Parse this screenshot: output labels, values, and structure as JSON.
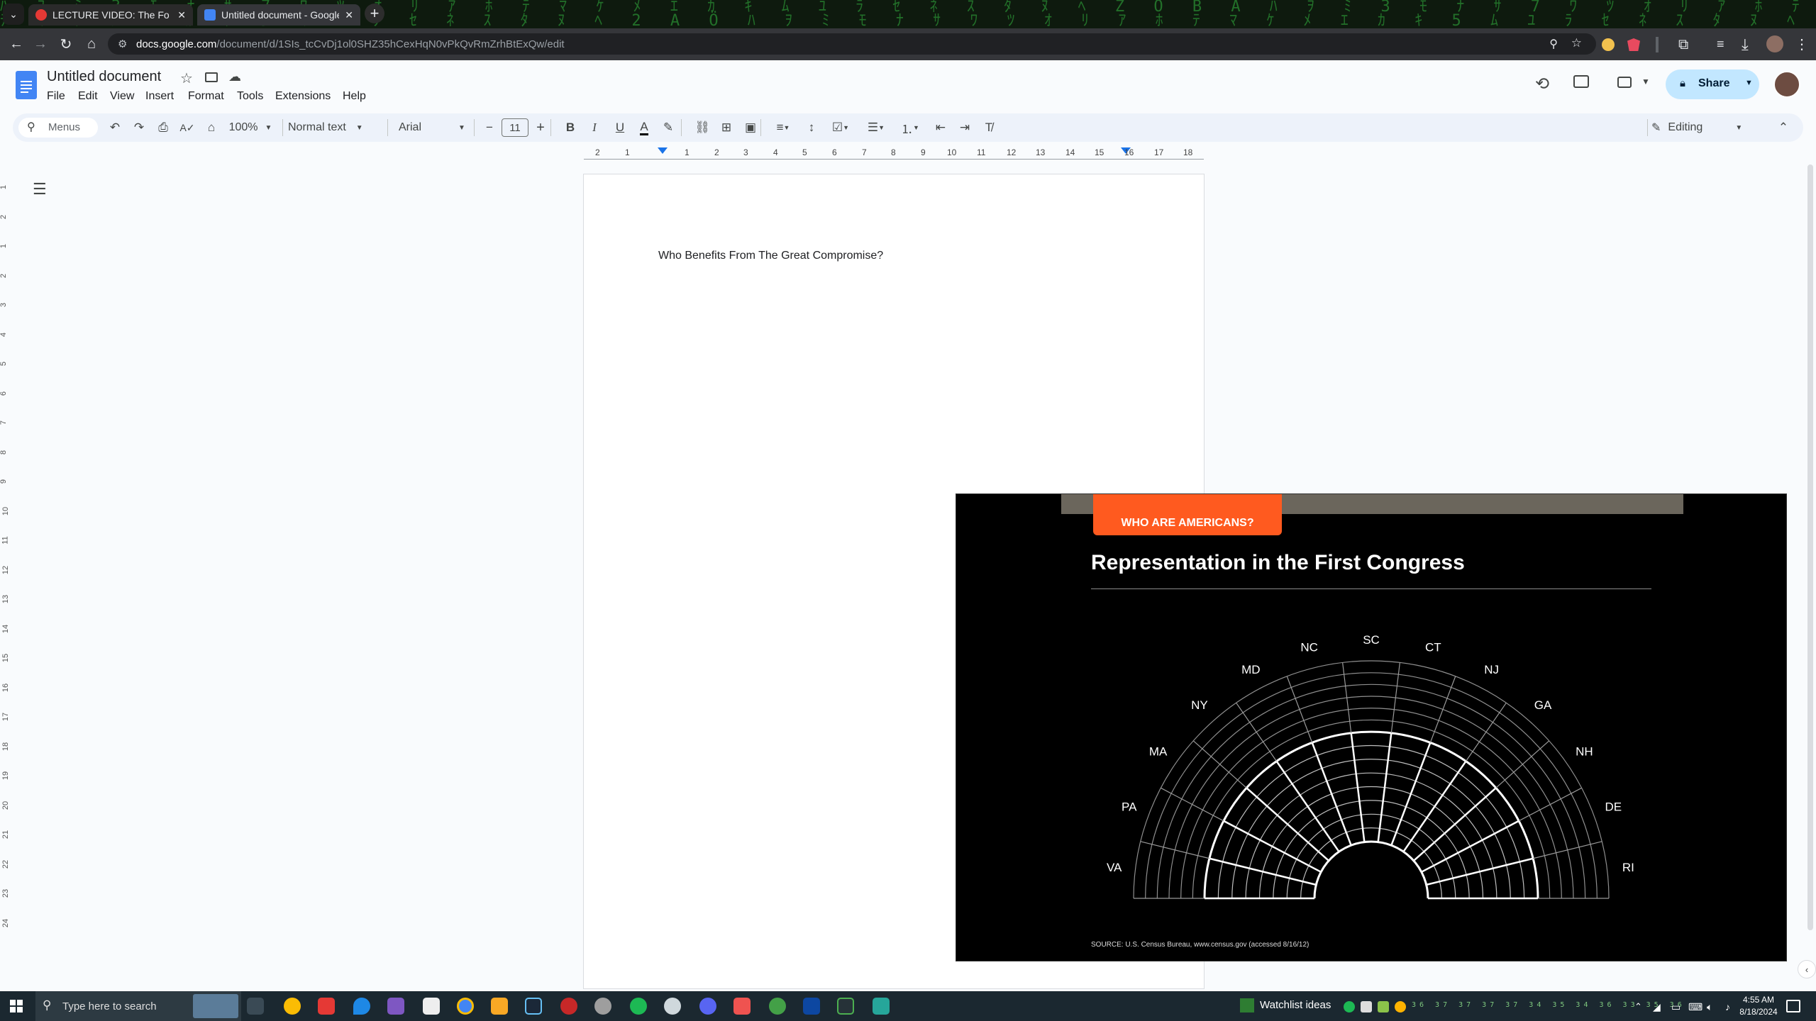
{
  "browser": {
    "tabs": [
      {
        "label": "LECTURE VIDEO: The Fo",
        "active": false
      },
      {
        "label": "Untitled document - Google Do",
        "active": true
      }
    ],
    "url_host": "docs.google.com",
    "url_path": "/document/d/1SIs_tcCvDj1ol0SHZ35hCexHqN0vPkQvRmZrhBtExQw/edit"
  },
  "docs": {
    "title": "Untitled document",
    "menu": [
      "File",
      "Edit",
      "View",
      "Insert",
      "Format",
      "Tools",
      "Extensions",
      "Help"
    ],
    "share_label": "Share",
    "toolbar": {
      "menus_label": "Menus",
      "zoom": "100%",
      "style": "Normal text",
      "font": "Arial",
      "font_size": "11",
      "mode": "Editing"
    },
    "ruler_labels": [
      "2",
      "1",
      "1",
      "2",
      "3",
      "4",
      "5",
      "6",
      "7",
      "8",
      "9",
      "10",
      "11",
      "12",
      "13",
      "14",
      "15",
      "16",
      "17",
      "18"
    ],
    "vruler_labels": [
      "1",
      "2",
      "1",
      "2",
      "3",
      "4",
      "5",
      "6",
      "7",
      "8",
      "9",
      "10",
      "11",
      "12",
      "13",
      "14",
      "15",
      "16",
      "17",
      "18",
      "19",
      "20",
      "21",
      "22",
      "23",
      "24"
    ],
    "body_text": "Who Benefits From The Great Compromise?"
  },
  "video": {
    "tag": "WHO ARE AMERICANS?",
    "title": "Representation in the First Congress",
    "states": [
      "VA",
      "PA",
      "MA",
      "NY",
      "MD",
      "NC",
      "SC",
      "CT",
      "NJ",
      "GA",
      "NH",
      "DE",
      "RI"
    ],
    "source": "SOURCE: U.S. Census Bureau, www.census.gov (accessed 8/16/12)"
  },
  "taskbar": {
    "search_placeholder": "Type here to search",
    "watchlist": "Watchlist ideas",
    "time": "4:55 AM",
    "date": "8/18/2024"
  },
  "colors": {
    "accent": "#0b57d0",
    "share_bg": "#c2e7ff",
    "slide_tag": "#ff5a1f"
  }
}
